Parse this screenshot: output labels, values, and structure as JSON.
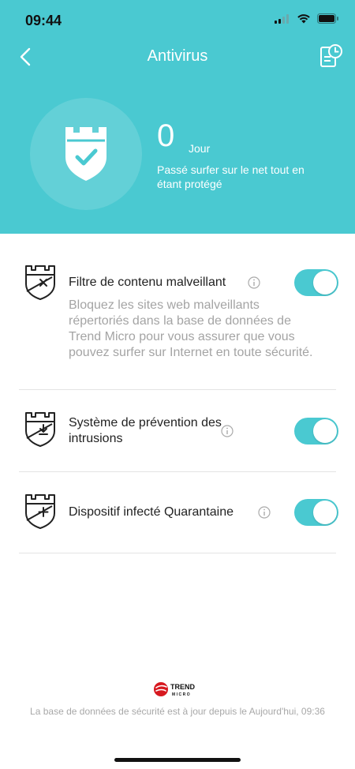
{
  "status_bar": {
    "time": "09:44",
    "icons": [
      "cellular-signal-icon",
      "wifi-icon",
      "battery-icon"
    ]
  },
  "header": {
    "title": "Antivirus",
    "back_icon": "chevron-left-icon",
    "history_icon": "history-icon",
    "background_color": "#4ac9d1"
  },
  "hero": {
    "icon": "shield-check-icon",
    "count": "0",
    "unit": "Jour",
    "description": "Passé surfer sur le net tout en étant protégé"
  },
  "features": [
    {
      "icon": "shield-x-icon",
      "title": "Filtre de contenu malveillant",
      "description": "Bloquez les sites web malveillants répertoriés dans la base de données de Trend Micro pour vous assurer que vous pouvez surfer sur Internet en toute sécurité.",
      "enabled": true
    },
    {
      "icon": "shield-download-icon",
      "title": "Système de prévention des intrusions",
      "enabled": true
    },
    {
      "icon": "shield-plus-icon",
      "title": "Dispositif infecté Quarantaine",
      "enabled": true
    }
  ],
  "footer": {
    "logo_icon": "trend-micro-logo-icon",
    "logo_text_top": "TREND",
    "logo_text_bottom": "MICRO",
    "text": "La base de données de sécurité est à jour depuis le Aujourd'hui, 09:36"
  },
  "colors": {
    "accent": "#4ac9d1",
    "logo_red": "#d71920"
  }
}
